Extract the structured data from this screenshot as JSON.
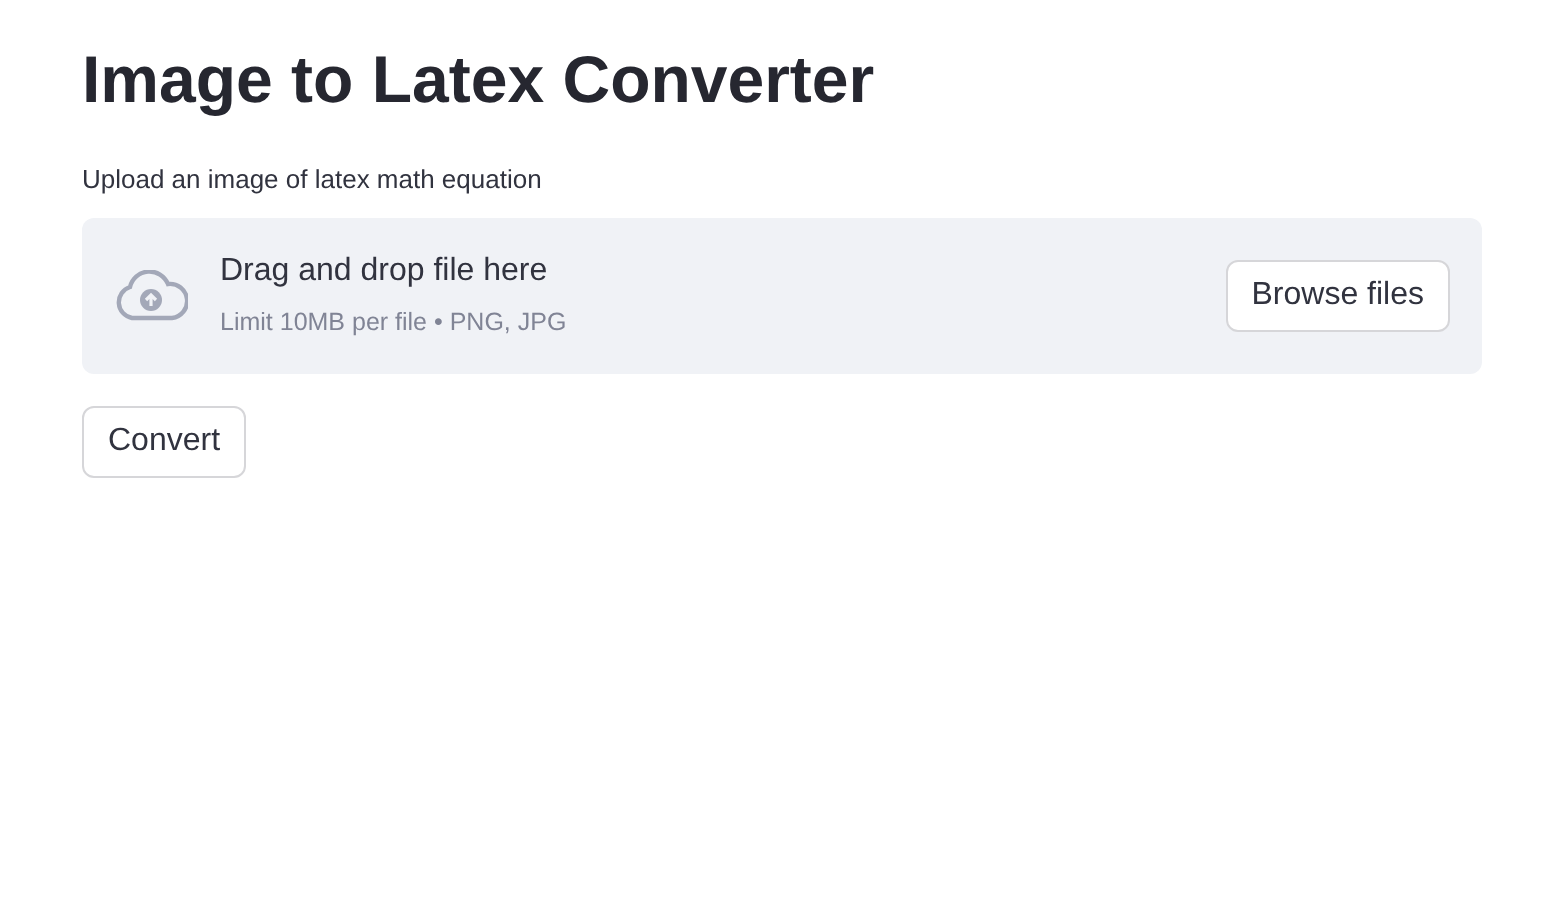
{
  "title": "Image to Latex Converter",
  "uploader": {
    "label": "Upload an image of latex math equation",
    "instruction": "Drag and drop file here",
    "limits": "Limit 10MB per file • PNG, JPG",
    "button": "Browse files"
  },
  "actions": [
    "Convert"
  ]
}
